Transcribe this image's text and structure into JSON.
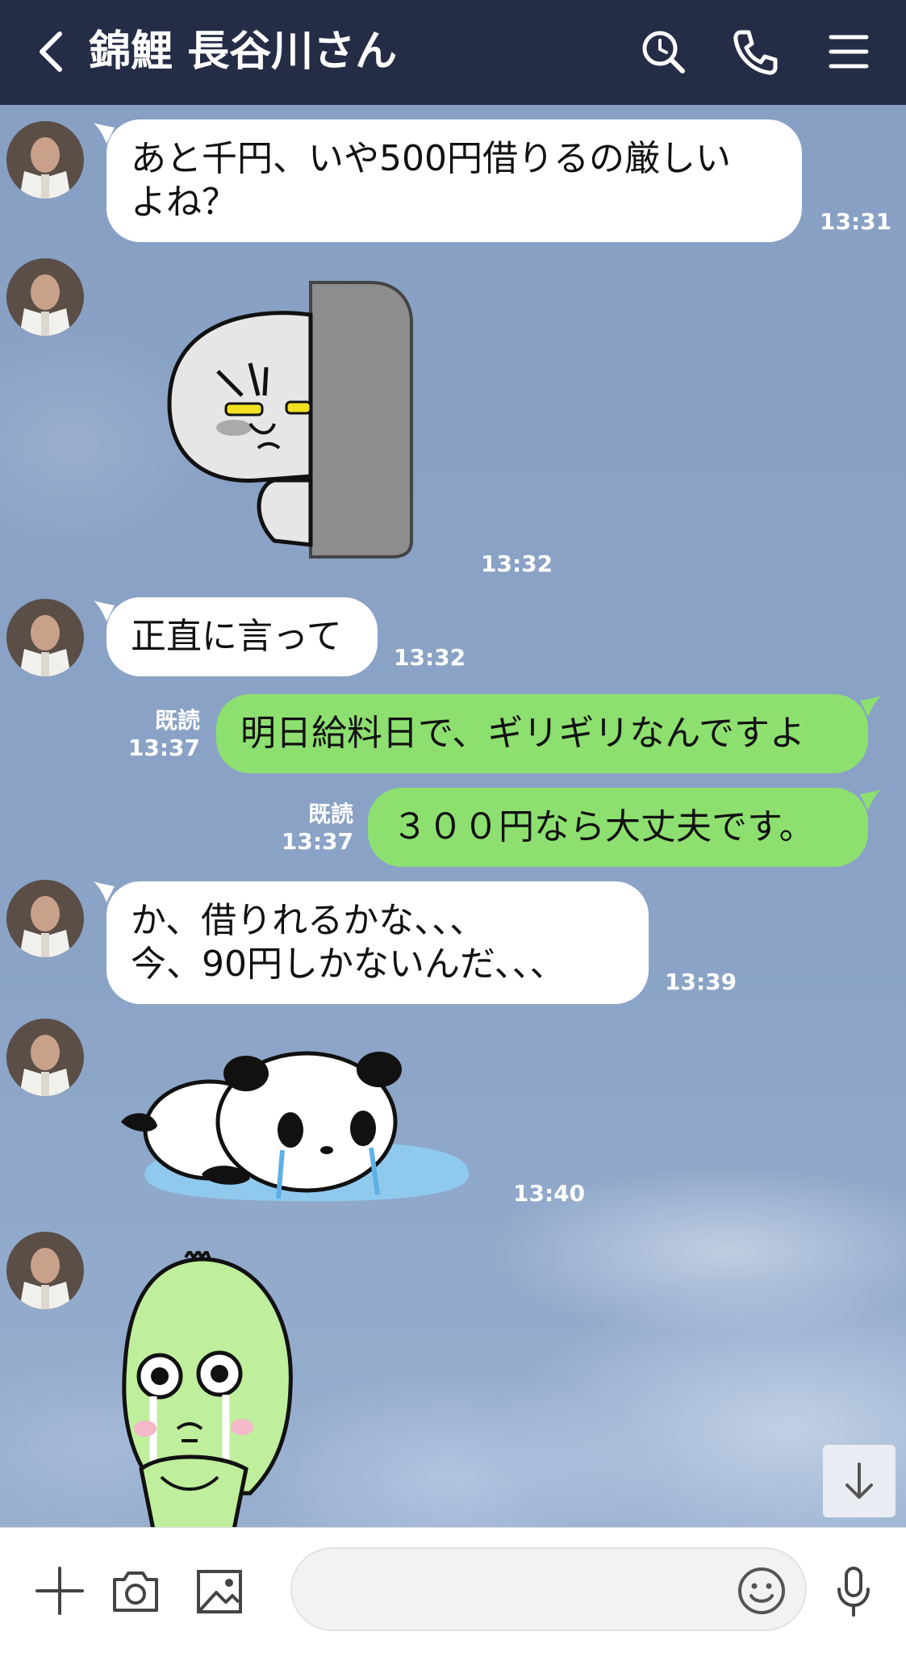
{
  "header": {
    "title": "錦鯉 長谷川さん",
    "background": "#252c46"
  },
  "messages": [
    {
      "from": "other",
      "lines": [
        "あと千円、いや500円借りるの厳しい",
        "よね？"
      ],
      "time": "13:31"
    },
    {
      "from": "other",
      "sticker": "peeking-face-sticker",
      "time": "13:32"
    },
    {
      "from": "other",
      "lines": [
        "正直に言って"
      ],
      "time": "13:32"
    },
    {
      "from": "me",
      "lines": [
        "明日給料日で、ギリギリなんですよ"
      ],
      "read": "既読",
      "time": "13:37"
    },
    {
      "from": "me",
      "lines": [
        "３００円なら大丈夫です。"
      ],
      "read": "既読",
      "time": "13:37"
    },
    {
      "from": "other",
      "lines": [
        "か、借りれるかな、、、",
        "今、90円しかないんだ、、、"
      ],
      "time": "13:39"
    },
    {
      "from": "other",
      "sticker": "crying-panda-sticker",
      "time": "13:40"
    },
    {
      "from": "other",
      "sticker": "crying-green-character-sticker"
    }
  ],
  "input": {
    "value": "",
    "placeholder": ""
  },
  "icons": {
    "back": "chevron-left-icon",
    "search": "search-icon",
    "call": "phone-icon",
    "menu": "hamburger-menu-icon",
    "scroll_down": "arrow-down-icon",
    "add": "plus-icon",
    "camera": "camera-icon",
    "image": "image-icon",
    "emoji": "smiley-icon",
    "voice": "microphone-icon"
  },
  "colors": {
    "incoming_bubble": "#ffffff",
    "outgoing_bubble": "#8de06f",
    "chat_background": "#8aa2c3"
  }
}
